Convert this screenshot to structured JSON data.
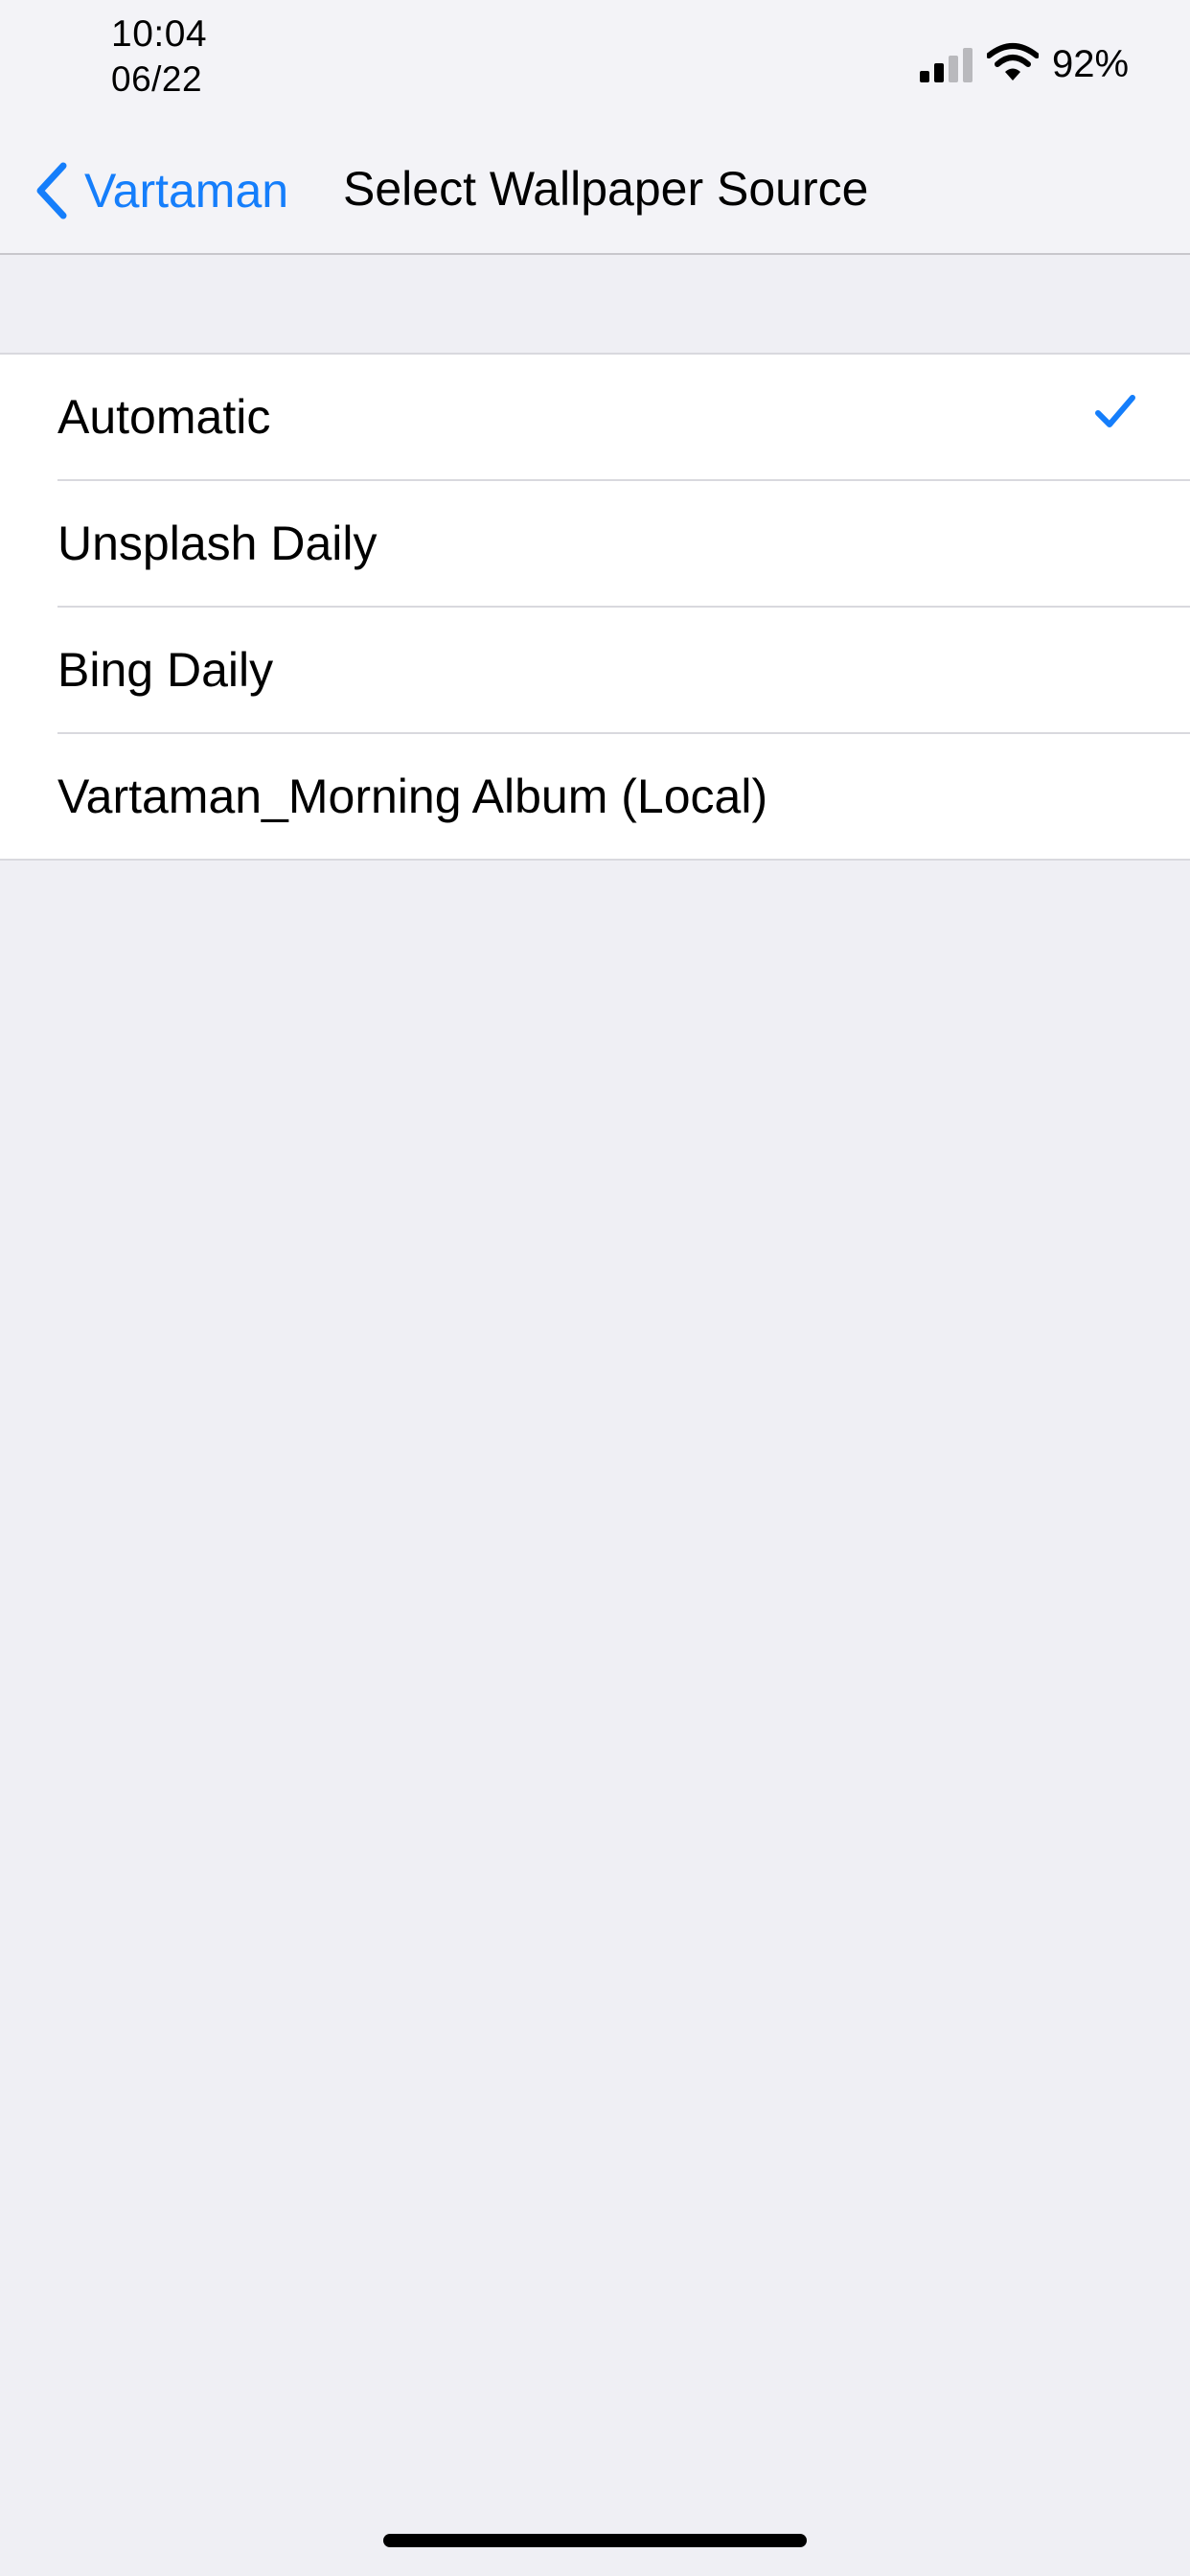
{
  "status_bar": {
    "time": "10:04",
    "date": "06/22",
    "battery_percent": "92%",
    "icons": [
      "signal-icon",
      "wifi-icon"
    ]
  },
  "nav_bar": {
    "back_label": "Vartaman",
    "title": "Select Wallpaper Source",
    "icons": [
      "chevron-left-icon"
    ]
  },
  "options": {
    "items": [
      {
        "label": "Automatic",
        "selected": true
      },
      {
        "label": "Unsplash Daily",
        "selected": false
      },
      {
        "label": "Bing Daily",
        "selected": false
      },
      {
        "label": "Vartaman_Morning Album (Local)",
        "selected": false
      }
    ],
    "selected_icon": "checkmark-icon"
  },
  "colors": {
    "accent": "#157efb",
    "background": "#efeff4",
    "list_background": "#ffffff",
    "separator": "#d9d9de"
  }
}
